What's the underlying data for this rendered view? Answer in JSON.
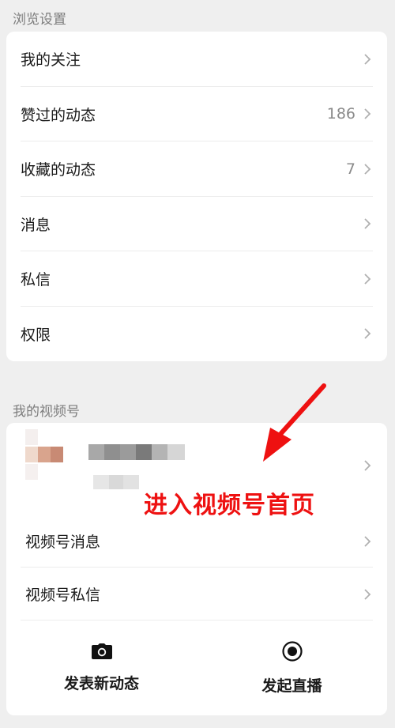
{
  "browse": {
    "title": "浏览设置",
    "items": [
      {
        "label": "我的关注",
        "count": ""
      },
      {
        "label": "赞过的动态",
        "count": "186"
      },
      {
        "label": "收藏的动态",
        "count": "7"
      },
      {
        "label": "消息",
        "count": ""
      },
      {
        "label": "私信",
        "count": ""
      },
      {
        "label": "权限",
        "count": ""
      }
    ]
  },
  "channels": {
    "title": "我的视频号",
    "items": [
      {
        "label": "视频号消息"
      },
      {
        "label": "视频号私信"
      }
    ],
    "post_label": "发表新动态",
    "live_label": "发起直播"
  },
  "annotation": {
    "text": "进入视频号首页",
    "color": "#ee1111"
  },
  "icons": {
    "chevron": "chevron-right-icon",
    "camera": "camera-icon",
    "live": "record-icon"
  }
}
